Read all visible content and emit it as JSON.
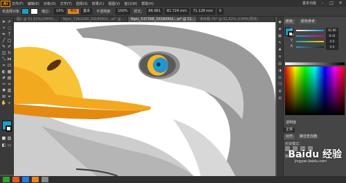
{
  "app": {
    "logo": "Ai"
  },
  "menu": [
    "文件(F)",
    "编辑(E)",
    "对象(O)",
    "文字(T)",
    "选择(S)",
    "效果(C)",
    "视图(V)",
    "窗口(W)",
    "帮助(H)"
  ],
  "menu_right": {
    "workspace": "基本功能",
    "minimize": "–",
    "maximize": "□",
    "close": "✕"
  },
  "control": {
    "selection": "未选择对象",
    "stroke_label": "描边：",
    "stroke_value": "10%",
    "profile": "等比",
    "basic": "基本",
    "opacity_label": "不透明度：",
    "opacity_value": "100%",
    "style_label": "样式：",
    "x_value": "86.981",
    "y_value": "81.724 mm",
    "w_value": "71.128 mm",
    "h_value": "0"
  },
  "tabs": [
    {
      "label": "图1 @ 51.52%(CMYK/...",
      "active": false
    },
    {
      "label": "Nipic_7262290_20180902...ai* @...",
      "active": false
    },
    {
      "label": "Nipic_537398_20180902...ai* @ 51...",
      "active": true
    },
    {
      "label": "未标题-70* @ 51.52% (CMYK/预览)",
      "active": false
    }
  ],
  "panel": {
    "color_tab": "颜色",
    "guide_tab": "颜色参考",
    "sliders": [
      {
        "label": "C",
        "value": "81.86",
        "color": "#00a0e0"
      },
      {
        "label": "M",
        "value": "8.33",
        "color": "#e0007a"
      },
      {
        "label": "Y",
        "value": "0.0",
        "color": "#f0d800"
      },
      {
        "label": "K",
        "value": "0.0",
        "color": "#222222"
      }
    ],
    "transparency_label": "透明度",
    "mode_label": "正常",
    "align_label": "对齐",
    "pathfinder_tab": "路径查找器",
    "shape_modes": "形状模式：",
    "pathfinders": "路径查找器："
  },
  "watermark": {
    "main": "Baidu 经验",
    "sub": "jingyan.baidu.com"
  },
  "colors": {
    "accent": "#e8841e",
    "fill": "#1aa0c8",
    "beak": "#f2a81f",
    "eye_blue": "#2d8fd0"
  }
}
